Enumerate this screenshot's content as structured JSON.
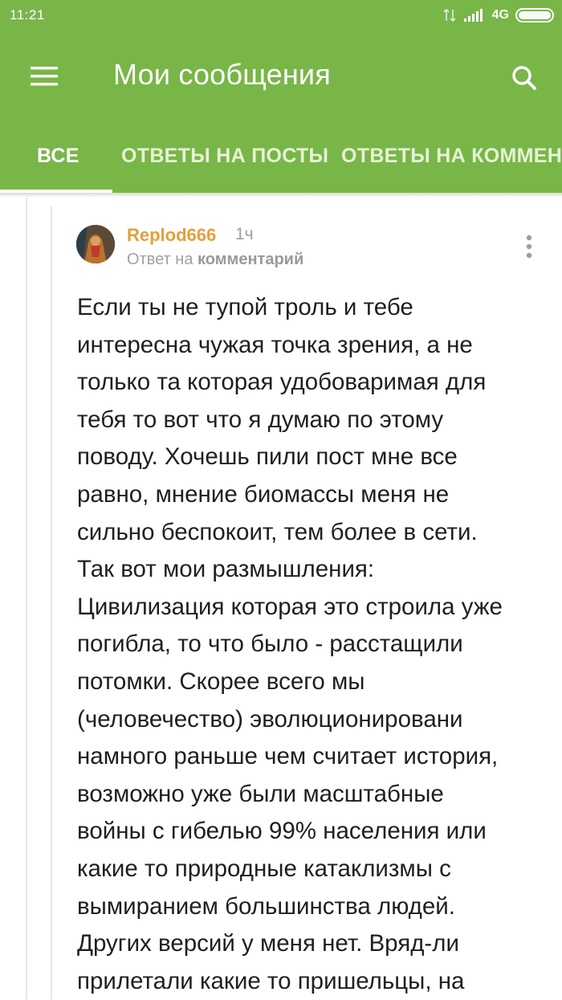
{
  "status_bar": {
    "time": "11:21",
    "network": "4G"
  },
  "app_bar": {
    "title": "Мои сообщения",
    "menu_icon": "hamburger-icon",
    "search_icon": "search-icon",
    "background_color": "#79b648"
  },
  "tabs": [
    {
      "label": "ВСЕ",
      "active": true
    },
    {
      "label": "ОТВЕТЫ НА ПОСТЫ",
      "active": false
    },
    {
      "label": "ОТВЕТЫ НА КОММЕНТАРИИ",
      "active": false
    }
  ],
  "comment": {
    "author": "Replod666",
    "time": "1ч",
    "reply_prefix": "Ответ на",
    "reply_target": "комментарий",
    "author_color": "#e2a03b",
    "lines": [
      "Если ты не тупой троль и тебе",
      "интересна чужая точка зрения, а не",
      "только та которая удобоваримая для",
      "тебя то вот что я думаю по этому",
      "поводу. Хочешь пили пост мне все",
      "равно, мнение биомассы меня не",
      "сильно беспокоит, тем более в сети.",
      "Так вот мои размышления:",
      "Цивилизация которая это строила уже",
      "погибла, то что было - расстащили",
      "потомки. Скорее всего мы",
      "(человечество) эволюционировани",
      "намного раньше чем считает история,",
      "возможно уже были масштабные",
      "войны с гибелью 99% населения или",
      "какие то природные катаклизмы с",
      "вымиранием большинства людей.",
      "Других версий у меня нет. Вряд-ли",
      "прилетали какие то пришельцы, на"
    ]
  }
}
